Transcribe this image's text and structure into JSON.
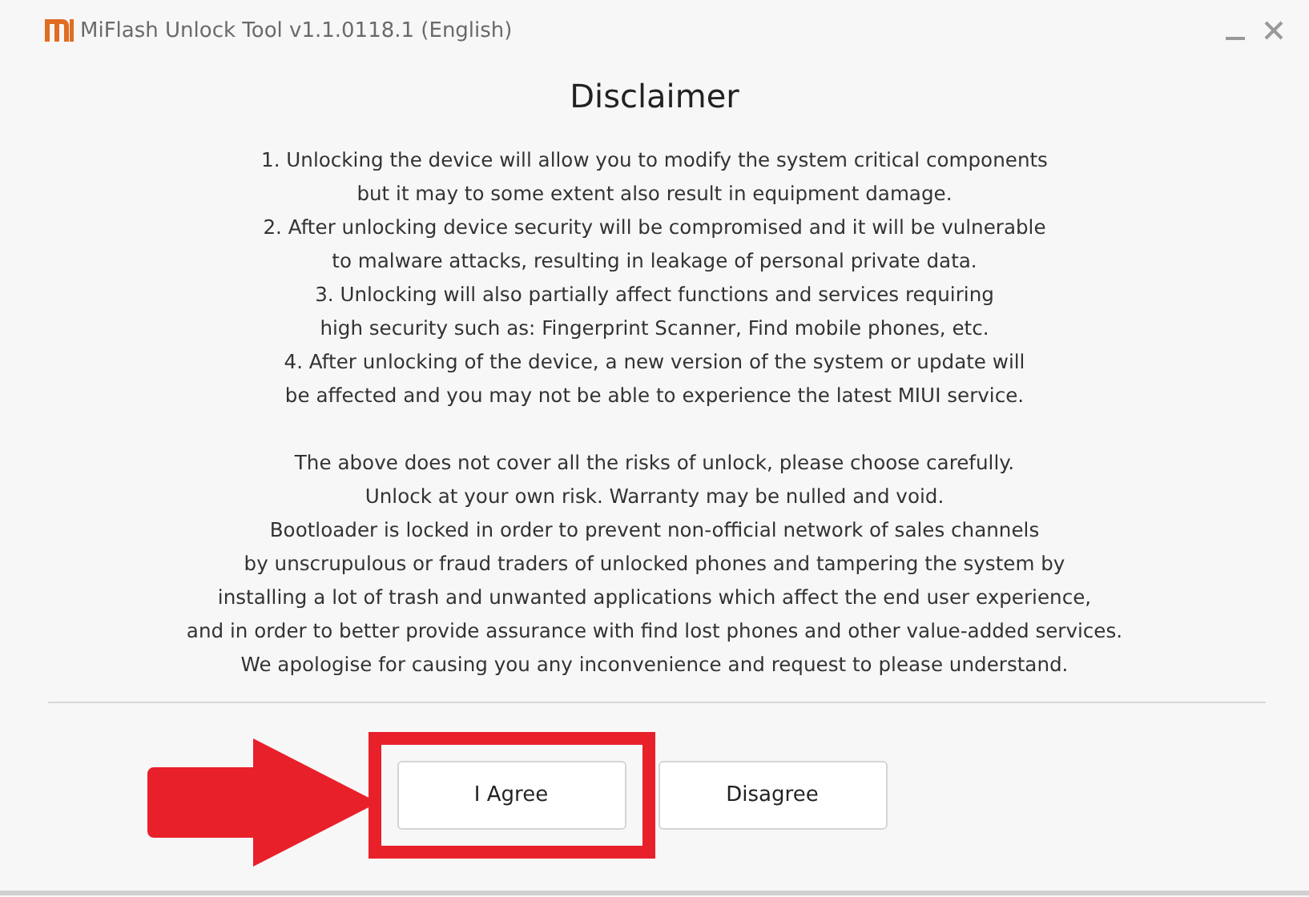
{
  "window": {
    "title": "MiFlash Unlock Tool v1.1.0118.1 (English)"
  },
  "heading": "Disclaimer",
  "paragraphs": [
    {
      "lines": [
        "1. Unlocking the device will allow you to modify the system critical components",
        "but it may to some extent also result in equipment damage."
      ]
    },
    {
      "lines": [
        "2. After unlocking device security will be compromised and it will be vulnerable",
        "to malware attacks, resulting in leakage of personal private data."
      ]
    },
    {
      "lines": [
        "3. Unlocking will also partially affect functions and services requiring",
        "high security such as: Fingerprint Scanner, Find mobile phones, etc."
      ]
    },
    {
      "lines": [
        "4. After unlocking of the device, a new version of the system or update will",
        "be affected and you may not be able to experience the latest MIUI service."
      ]
    },
    {
      "lines": [
        "The above does not cover all the risks of unlock, please choose carefully.",
        "Unlock at your own risk. Warranty may be nulled and void.",
        "Bootloader is locked in order to prevent non-official network of sales channels",
        "by unscrupulous or fraud traders of unlocked phones and tampering the system by",
        "installing a lot of trash and unwanted applications which affect the end user experience,",
        "and in order to better provide assurance with find lost phones and other value-added services.",
        "We apologise for causing you any inconvenience and request to please understand."
      ]
    }
  ],
  "buttons": [
    {
      "label": "I Agree",
      "highlighted": true
    },
    {
      "label": "Disagree",
      "highlighted": false
    }
  ]
}
